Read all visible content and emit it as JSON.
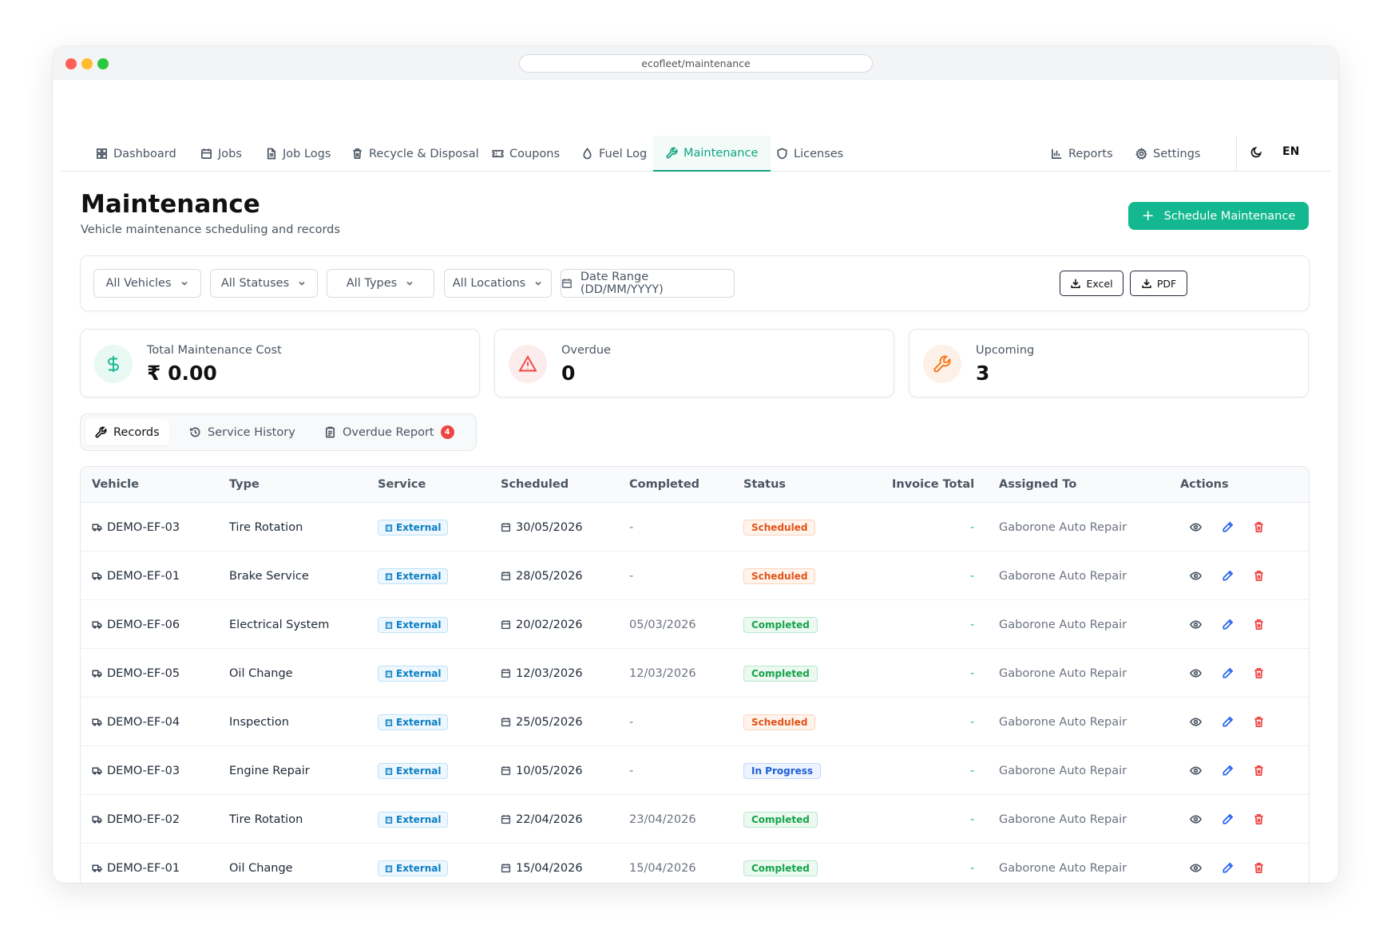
{
  "browser": {
    "url": "ecofleet/maintenance"
  },
  "nav": {
    "items": [
      {
        "label": "Dashboard",
        "icon": "grid-icon"
      },
      {
        "label": "Jobs",
        "icon": "calendar-icon"
      },
      {
        "label": "Job Logs",
        "icon": "file-icon"
      },
      {
        "label": "Recycle & Disposal",
        "icon": "trash-icon"
      },
      {
        "label": "Coupons",
        "icon": "ticket-icon"
      },
      {
        "label": "Fuel Log",
        "icon": "droplet-icon"
      },
      {
        "label": "Maintenance",
        "icon": "wrench-icon",
        "active": true
      },
      {
        "label": "Licenses",
        "icon": "shield-icon"
      }
    ],
    "right_items": [
      {
        "label": "Reports",
        "icon": "bar-chart-icon"
      },
      {
        "label": "Settings",
        "icon": "gear-icon"
      }
    ],
    "language": "EN"
  },
  "page": {
    "title": "Maintenance",
    "subtitle": "Vehicle maintenance scheduling and records",
    "primary_button": "Schedule Maintenance"
  },
  "filters": {
    "vehicles": "All Vehicles",
    "statuses": "All Statuses",
    "types": "All Types",
    "locations": "All Locations",
    "date_range": "Date Range (DD/MM/YYYY)",
    "export_excel": "Excel",
    "export_pdf": "PDF"
  },
  "stats": [
    {
      "label": "Total Maintenance Cost",
      "value": "₹ 0.00",
      "icon": "dollar-icon",
      "color": "#14b890"
    },
    {
      "label": "Overdue",
      "value": "0",
      "icon": "alert-triangle-icon",
      "color": "#ef4444"
    },
    {
      "label": "Upcoming",
      "value": "3",
      "icon": "wrench-icon",
      "color": "#f97316"
    }
  ],
  "tabs": [
    {
      "label": "Records",
      "icon": "wrench-icon",
      "active": true
    },
    {
      "label": "Service History",
      "icon": "history-icon"
    },
    {
      "label": "Overdue Report",
      "icon": "clipboard-icon",
      "badge": "4"
    }
  ],
  "table": {
    "headers": [
      "Vehicle",
      "Type",
      "Service",
      "Scheduled",
      "Completed",
      "Status",
      "Invoice Total",
      "Assigned To",
      "Actions"
    ],
    "rows": [
      {
        "vehicle": "DEMO-EF-03",
        "type": "Tire Rotation",
        "service": "External",
        "scheduled": "30/05/2026",
        "completed": "-",
        "status": "Scheduled",
        "invoice": "-",
        "assigned": "Gaborone Auto Repair"
      },
      {
        "vehicle": "DEMO-EF-01",
        "type": "Brake Service",
        "service": "External",
        "scheduled": "28/05/2026",
        "completed": "-",
        "status": "Scheduled",
        "invoice": "-",
        "assigned": "Gaborone Auto Repair"
      },
      {
        "vehicle": "DEMO-EF-06",
        "type": "Electrical System",
        "service": "External",
        "scheduled": "20/02/2026",
        "completed": "05/03/2026",
        "status": "Completed",
        "invoice": "-",
        "assigned": "Gaborone Auto Repair"
      },
      {
        "vehicle": "DEMO-EF-05",
        "type": "Oil Change",
        "service": "External",
        "scheduled": "12/03/2026",
        "completed": "12/03/2026",
        "status": "Completed",
        "invoice": "-",
        "assigned": "Gaborone Auto Repair"
      },
      {
        "vehicle": "DEMO-EF-04",
        "type": "Inspection",
        "service": "External",
        "scheduled": "25/05/2026",
        "completed": "-",
        "status": "Scheduled",
        "invoice": "-",
        "assigned": "Gaborone Auto Repair"
      },
      {
        "vehicle": "DEMO-EF-03",
        "type": "Engine Repair",
        "service": "External",
        "scheduled": "10/05/2026",
        "completed": "-",
        "status": "In Progress",
        "invoice": "-",
        "assigned": "Gaborone Auto Repair"
      },
      {
        "vehicle": "DEMO-EF-02",
        "type": "Tire Rotation",
        "service": "External",
        "scheduled": "22/04/2026",
        "completed": "23/04/2026",
        "status": "Completed",
        "invoice": "-",
        "assigned": "Gaborone Auto Repair"
      },
      {
        "vehicle": "DEMO-EF-01",
        "type": "Oil Change",
        "service": "External",
        "scheduled": "15/04/2026",
        "completed": "15/04/2026",
        "status": "Completed",
        "invoice": "-",
        "assigned": "Gaborone Auto Repair"
      }
    ]
  },
  "colors": {
    "accent": "#14b890",
    "danger": "#ef4444",
    "warning": "#f97316",
    "info": "#0b7fc4"
  }
}
